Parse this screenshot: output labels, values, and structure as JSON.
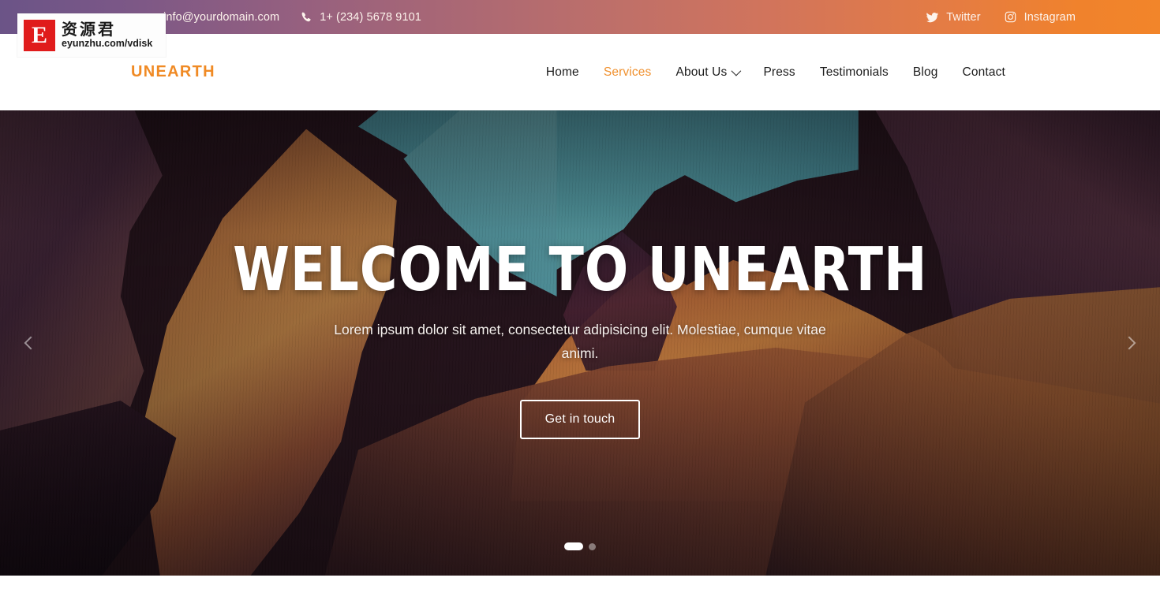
{
  "topbar": {
    "email": "info@yourdomain.com",
    "email_icon": "envelope-icon",
    "phone": "1+ (234) 5678 9101",
    "phone_icon": "phone-icon",
    "social": [
      {
        "label": "Twitter",
        "icon": "twitter-icon"
      },
      {
        "label": "Instagram",
        "icon": "instagram-icon"
      }
    ],
    "gradient_from": "#6b5487",
    "gradient_to": "#f2852a"
  },
  "nav": {
    "brand": "UNEARTH",
    "brand_color": "#f08a24",
    "active_color": "#f0912f",
    "items": [
      {
        "label": "Home",
        "active": false,
        "has_dropdown": false
      },
      {
        "label": "Services",
        "active": true,
        "has_dropdown": false
      },
      {
        "label": "About Us",
        "active": false,
        "has_dropdown": true
      },
      {
        "label": "Press",
        "active": false,
        "has_dropdown": false
      },
      {
        "label": "Testimonials",
        "active": false,
        "has_dropdown": false
      },
      {
        "label": "Blog",
        "active": false,
        "has_dropdown": false
      },
      {
        "label": "Contact",
        "active": false,
        "has_dropdown": false
      }
    ]
  },
  "hero": {
    "title": "Welcome to Unearth",
    "subtitle": "Lorem ipsum dolor sit amet, consectetur adipisicing elit. Molestiae, cumque vitae animi.",
    "cta_label": "Get in touch",
    "prev_icon": "chevron-left-icon",
    "next_icon": "chevron-right-icon",
    "slides": [
      {
        "active": true
      },
      {
        "active": false
      }
    ]
  },
  "watermark": {
    "logo_letter": "E",
    "chinese": "资源君",
    "url": "eyunzhu.com/vdisk",
    "logo_color": "#e01b1b"
  }
}
